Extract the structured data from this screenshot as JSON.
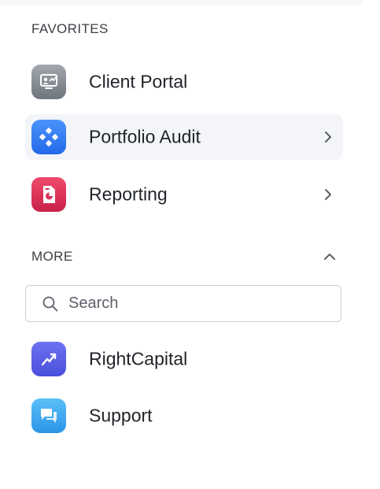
{
  "favorites": {
    "header": "FAVORITES",
    "items": [
      {
        "label": "Client Portal",
        "icon": "client-portal-icon",
        "color": "#8e949c"
      },
      {
        "label": "Portfolio Audit",
        "icon": "portfolio-audit-icon",
        "color": "#2f7cf6"
      },
      {
        "label": "Reporting",
        "icon": "reporting-icon",
        "color": "#d9345a"
      }
    ]
  },
  "more": {
    "header": "MORE",
    "search": {
      "placeholder": "Search",
      "value": ""
    },
    "items": [
      {
        "label": "RightCapital",
        "icon": "rightcapital-icon",
        "color": "#5a5ee8"
      },
      {
        "label": "Support",
        "icon": "support-icon",
        "color": "#3ea8ee"
      }
    ]
  }
}
